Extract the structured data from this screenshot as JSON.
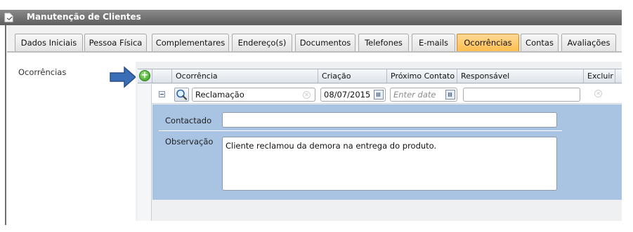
{
  "window": {
    "title": "Manutenção de Clientes"
  },
  "tabs": [
    {
      "label": "Dados Iniciais"
    },
    {
      "label": "Pessoa Física"
    },
    {
      "label": "Complementares"
    },
    {
      "label": "Endereço(s)"
    },
    {
      "label": "Documentos"
    },
    {
      "label": "Telefones"
    },
    {
      "label": "E-mails"
    },
    {
      "label": "Ocorrências",
      "active": true
    },
    {
      "label": "Contas"
    },
    {
      "label": "Avaliações"
    }
  ],
  "section": {
    "label": "Ocorrências"
  },
  "grid": {
    "add_icon": "plus-circle-icon",
    "columns": [
      "Ocorrência",
      "Criação",
      "Próximo Contato",
      "Responsável",
      "Excluir"
    ],
    "row": {
      "ocorrencia": "Reclamação",
      "criacao": "08/07/2015",
      "proximo_contato_placeholder": "Enter date",
      "responsavel": ""
    }
  },
  "details": {
    "contactado_label": "Contactado",
    "contactado_value": "",
    "observacao_label": "Observação",
    "observacao_value": "Cliente reclamou da demora na entrega do produto."
  },
  "colors": {
    "active_tab": "#ffbb48",
    "detail_panel": "#a9c3e3",
    "arrow": "#3a6fb8"
  }
}
